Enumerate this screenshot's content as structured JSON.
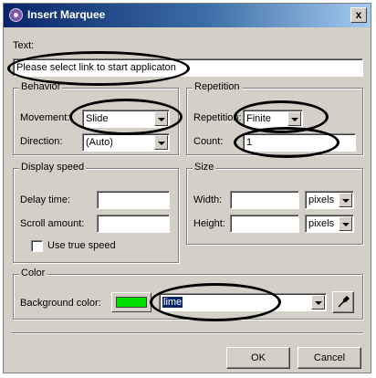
{
  "window": {
    "title": "Insert Marquee",
    "close_label": "x"
  },
  "text_section": {
    "label": "Text:",
    "value": "Please select link to start applicaton"
  },
  "behavior": {
    "title": "Behavior",
    "movement_label": "Movement:",
    "movement_value": "Slide",
    "direction_label": "Direction:",
    "direction_value": "(Auto)"
  },
  "repetition": {
    "title": "Repetition",
    "repetition_label": "Repetition:",
    "repetition_value": "Finite",
    "count_label": "Count:",
    "count_value": "1"
  },
  "display_speed": {
    "title": "Display speed",
    "delay_label": "Delay time:",
    "delay_value": "",
    "scroll_label": "Scroll amount:",
    "scroll_value": "",
    "true_speed_label": "Use true speed"
  },
  "size": {
    "title": "Size",
    "width_label": "Width:",
    "width_value": "",
    "width_unit": "pixels",
    "height_label": "Height:",
    "height_value": "",
    "height_unit": "pixels"
  },
  "color": {
    "title": "Color",
    "bg_label": "Background color:",
    "swatch_color": "#00e000",
    "value": "lime"
  },
  "buttons": {
    "ok": "OK",
    "cancel": "Cancel"
  }
}
